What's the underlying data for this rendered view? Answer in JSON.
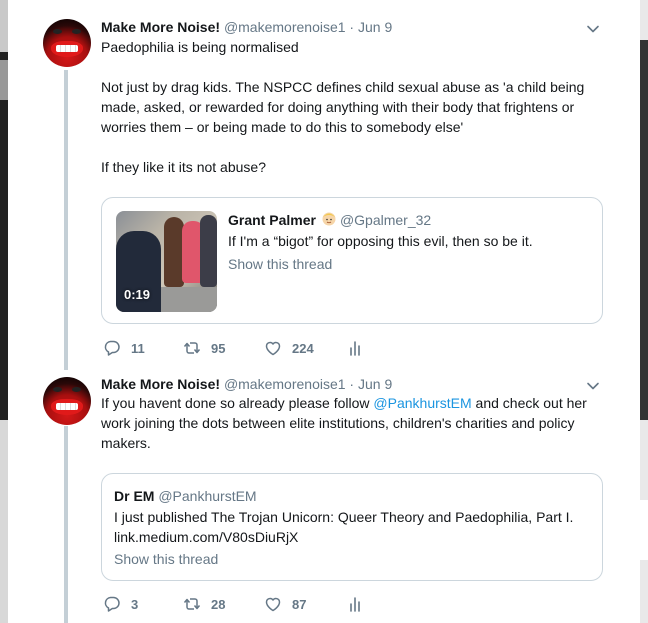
{
  "tweets": [
    {
      "display_name": "Make More Noise!",
      "handle": "@makemorenoise1",
      "separator": " · ",
      "date": "Jun 9",
      "lines": [
        "Paedophilia is being normalised",
        "",
        "Not just by drag kids. The NSPCC  defines child sexual abuse as 'a child being",
        "made, asked, or rewarded for doing anything with their body that frightens or",
        "worries them – or being made to do this to somebody else'",
        "",
        "If they like it its not abuse?"
      ],
      "quote": {
        "display_name": "Grant Palmer",
        "handle": "@Gpalmer_32",
        "text": "If I'm a “bigot” for opposing this evil, then so be it.",
        "link": "Show this thread",
        "video_duration": "0:19"
      },
      "actions": {
        "replies": "11",
        "retweets": "95",
        "likes": "224"
      }
    },
    {
      "display_name": "Make More Noise!",
      "handle": "@makemorenoise1",
      "separator": " · ",
      "date": "Jun 9",
      "text_before": "If you havent done so already please follow ",
      "mention": "@PankhurstEM",
      "text_after": " and check out her",
      "line2": "work joining the dots between elite institutions, children's charities and policy",
      "line3": "makers.",
      "quote": {
        "display_name": "Dr EM",
        "handle": "@PankhurstEM",
        "text_line1": "I just published The Trojan Unicorn: Queer Theory and Paedophilia, Part I.",
        "text_line2": "link.medium.com/V80sDiuRjX",
        "link": "Show this thread"
      },
      "actions": {
        "replies": "3",
        "retweets": "28",
        "likes": "87"
      }
    }
  ],
  "colors": {
    "text": "#14171a",
    "muted": "#657786",
    "link": "#1b95e0",
    "border": "#ccd6dd",
    "thread_line": "#c4cfd6"
  },
  "icons": [
    "chevron-down-icon",
    "reply-icon",
    "retweet-icon",
    "like-icon",
    "analytics-icon",
    "avatar-lips"
  ]
}
